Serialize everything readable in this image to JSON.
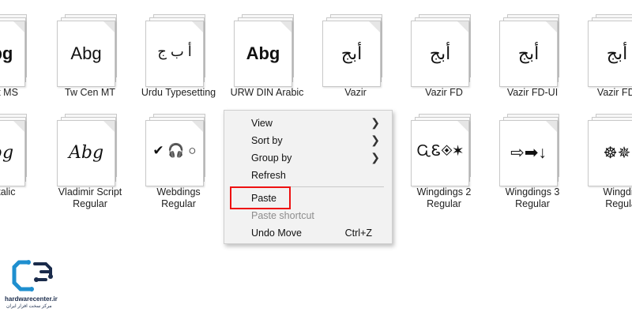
{
  "fonts_row1": [
    {
      "sample": "Abg",
      "label": "chet MS"
    },
    {
      "sample": "Abg",
      "label": "Tw Cen MT"
    },
    {
      "sample": "أ ب ج",
      "label": "Urdu Typesetting"
    },
    {
      "sample": "Abg",
      "label": "URW DIN Arabic"
    },
    {
      "sample": "أبج",
      "label": "Vazir"
    },
    {
      "sample": "أبج",
      "label": "Vazir FD"
    },
    {
      "sample": "أبج",
      "label": "Vazir FD-UI"
    },
    {
      "sample": "أبج",
      "label": "Vazir FD-V"
    }
  ],
  "fonts_row2": [
    {
      "sample": "Abg",
      "label": "di Italic",
      "label2": ""
    },
    {
      "sample": "Abg",
      "label": "Vladimir Script",
      "label2": "Regular"
    },
    {
      "sample": "✔ 🎧 ○",
      "label": "Webdings",
      "label2": "Regular"
    },
    {
      "sample": "ᏩᏋ◈✶",
      "label": "Wingdings 2",
      "label2": "Regular"
    },
    {
      "sample": "⇨➡↓",
      "label": "Wingdings 3",
      "label2": "Regular"
    },
    {
      "sample": "☸✵",
      "label": "Wingdin",
      "label2": "Regula"
    }
  ],
  "context_menu": {
    "items": [
      {
        "label": "View",
        "submenu": true
      },
      {
        "label": "Sort by",
        "submenu": true
      },
      {
        "label": "Group by",
        "submenu": true
      },
      {
        "label": "Refresh"
      },
      {
        "label": "Paste",
        "highlighted": true
      },
      {
        "label": "Paste shortcut",
        "disabled": true
      },
      {
        "label": "Undo Move",
        "shortcut": "Ctrl+Z"
      }
    ],
    "arrow": "❯"
  },
  "watermark": {
    "line1": "hardwarecenter.ir",
    "line2": "مرکز سخت افزار ایران"
  },
  "colors": {
    "highlight_border": "#e11111",
    "menu_bg": "#f2f2f2",
    "logo": "#1f8fcf"
  }
}
